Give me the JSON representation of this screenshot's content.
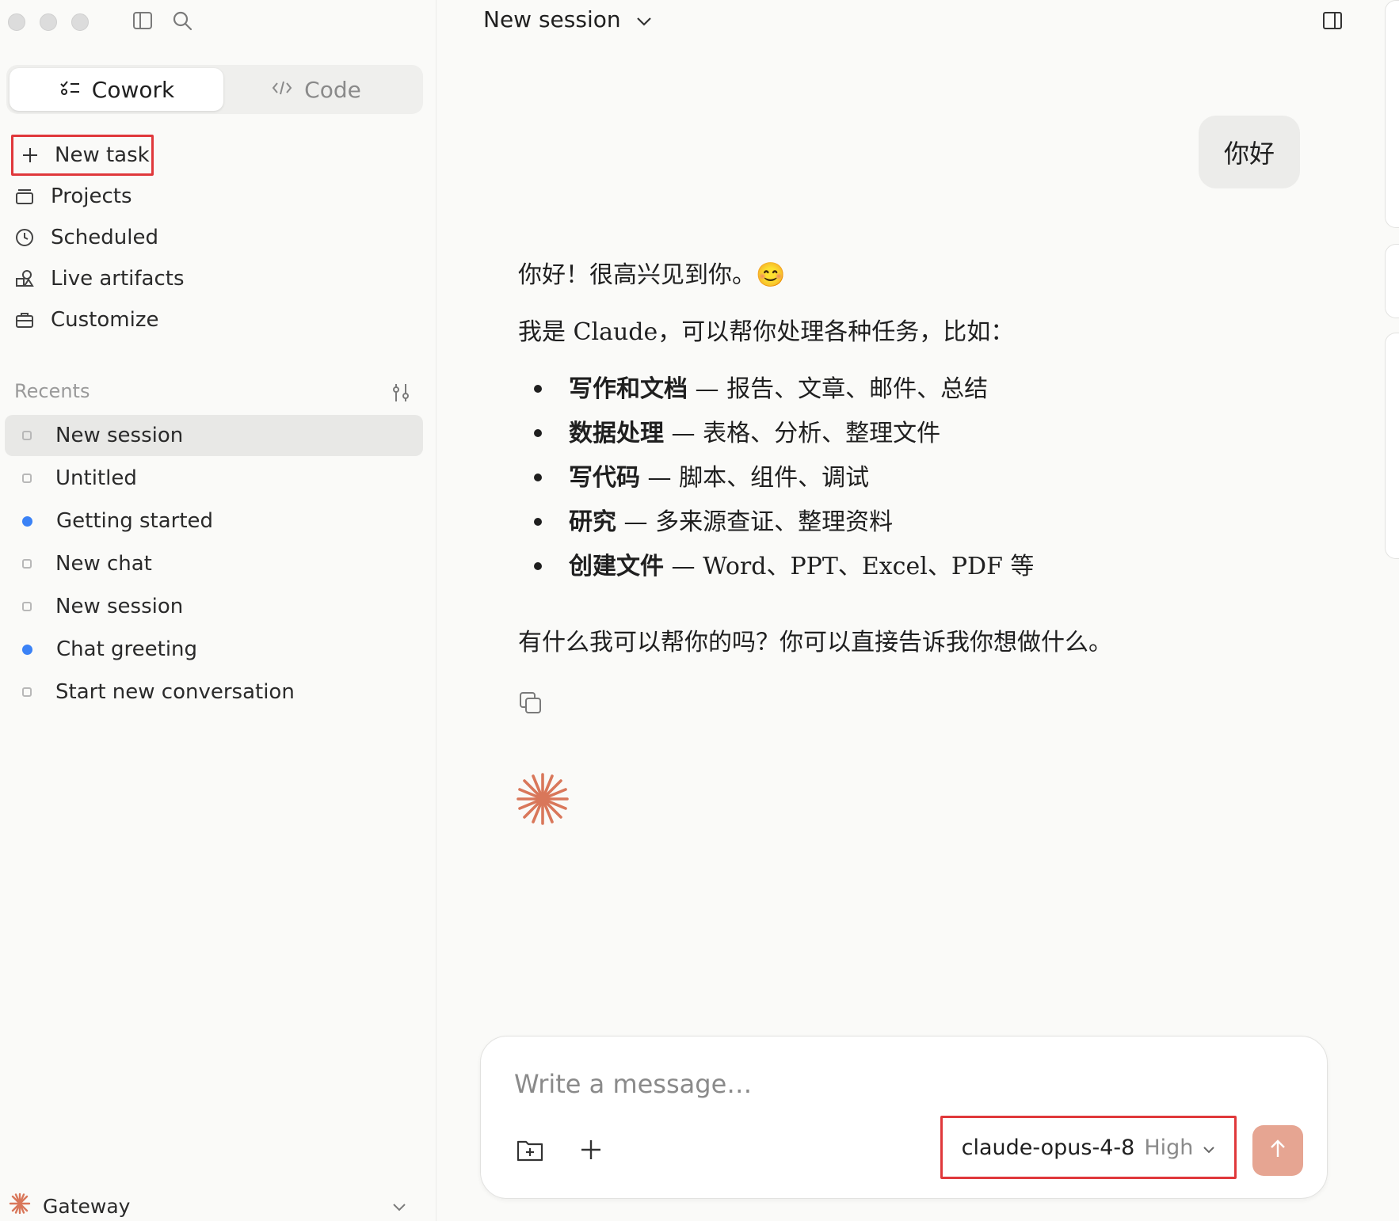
{
  "window": {
    "controls": [
      "close",
      "minimize",
      "zoom"
    ]
  },
  "sidebar": {
    "mode_tabs": [
      {
        "label": "Cowork",
        "icon": "tasks-icon",
        "active": true
      },
      {
        "label": "Code",
        "icon": "code-icon",
        "active": false
      }
    ],
    "nav": [
      {
        "label": "New task",
        "icon": "plus-icon"
      },
      {
        "label": "Projects",
        "icon": "folder-icon"
      },
      {
        "label": "Scheduled",
        "icon": "clock-icon"
      },
      {
        "label": "Live artifacts",
        "icon": "shapes-icon"
      },
      {
        "label": "Customize",
        "icon": "briefcase-icon"
      }
    ],
    "recents_label": "Recents",
    "recents": [
      {
        "label": "New session",
        "status": "idle",
        "selected": true
      },
      {
        "label": "Untitled",
        "status": "idle"
      },
      {
        "label": "Getting started",
        "status": "unread"
      },
      {
        "label": "New chat",
        "status": "idle"
      },
      {
        "label": "New session",
        "status": "idle"
      },
      {
        "label": "Chat greeting",
        "status": "unread"
      },
      {
        "label": "Start new conversation",
        "status": "idle"
      }
    ],
    "footer": {
      "label": "Gateway"
    }
  },
  "header": {
    "title": "New session"
  },
  "conversation": {
    "user_message": "你好",
    "assistant": {
      "greeting": "你好！很高兴见到你。😊",
      "intro": "我是 Claude，可以帮你处理各种任务，比如：",
      "items": [
        {
          "title": "写作和文档",
          "detail": " — 报告、文章、邮件、总结"
        },
        {
          "title": "数据处理",
          "detail": " — 表格、分析、整理文件"
        },
        {
          "title": "写代码",
          "detail": " — 脚本、组件、调试"
        },
        {
          "title": "研究",
          "detail": " — 多来源查证、整理资料"
        },
        {
          "title": "创建文件",
          "detail": " — Word、PPT、Excel、PDF 等"
        }
      ],
      "closing": "有什么我可以帮你的吗？你可以直接告诉我你想做什么。"
    }
  },
  "composer": {
    "placeholder": "Write a message…",
    "model": "claude-opus-4-8",
    "effort": "High"
  },
  "colors": {
    "accent": "#d9775a",
    "send_button": "#e6a592",
    "highlight": "#e0383b",
    "unread_dot": "#3b82f6"
  }
}
